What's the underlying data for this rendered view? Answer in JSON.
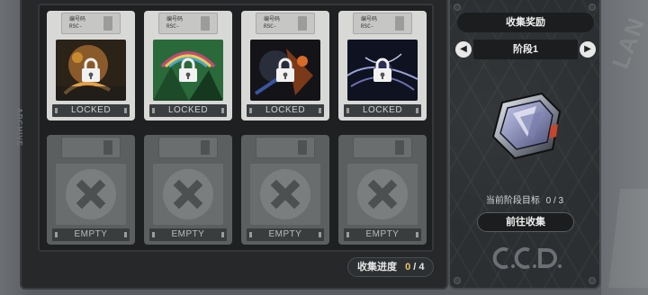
{
  "side_label": "ARCHIVE",
  "watermark": "LAN",
  "disks": [
    {
      "state": "locked",
      "code_line1": "编号码",
      "code_line2": "RSC-",
      "tag": "",
      "status": "LOCKED",
      "cover": "cover-orange"
    },
    {
      "state": "locked",
      "code_line1": "编号码",
      "code_line2": "RSC-",
      "tag": "",
      "status": "LOCKED",
      "cover": "cover-green"
    },
    {
      "state": "locked",
      "code_line1": "编号码",
      "code_line2": "RSC-",
      "tag": "",
      "status": "LOCKED",
      "cover": "cover-dark"
    },
    {
      "state": "locked",
      "code_line1": "编号码",
      "code_line2": "RSC-",
      "tag": "",
      "status": "LOCKED",
      "cover": "cover-navy"
    },
    {
      "state": "empty",
      "status": "EMPTY"
    },
    {
      "state": "empty",
      "status": "EMPTY"
    },
    {
      "state": "empty",
      "status": "EMPTY"
    },
    {
      "state": "empty",
      "status": "EMPTY"
    }
  ],
  "progress": {
    "label": "收集进度",
    "current": "0",
    "separator": "/",
    "total": "4"
  },
  "reward_panel": {
    "title": "收集奖励",
    "stage_label": "阶段1",
    "prev_icon": "chevron-left-icon",
    "next_icon": "chevron-right-icon",
    "target_label": "当前阶段目标",
    "target_value": "0 / 3",
    "goto_button": "前往收集",
    "logo_text": "C.C.D."
  },
  "colors": {
    "accent_gold": "#e8c66a",
    "panel_dark": "#26282a",
    "disk_locked": "#d8d8d6",
    "disk_empty": "#5c5f60"
  }
}
